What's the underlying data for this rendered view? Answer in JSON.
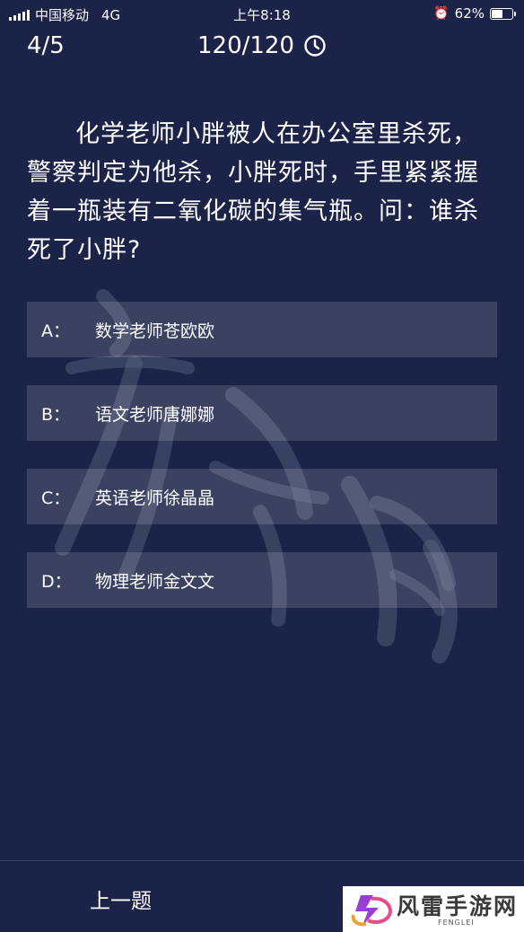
{
  "status": {
    "carrier": "中国移动",
    "network": "4G",
    "time": "上午8:18",
    "battery": "62%",
    "battery_level": 0.62
  },
  "header": {
    "progress": "4/5",
    "timer": "120/120"
  },
  "question": {
    "text": "化学老师小胖被人在办公室里杀死，警察判定为他杀，小胖死时，手里紧紧握着一瓶装有二氧化碳的集气瓶。问：谁杀死了小胖?"
  },
  "options": [
    {
      "key": "A：",
      "text": "数学老师苍欧欧"
    },
    {
      "key": "B：",
      "text": "语文老师唐娜娜"
    },
    {
      "key": "C：",
      "text": "英语老师徐晶晶"
    },
    {
      "key": "D：",
      "text": "物理老师金文文"
    }
  ],
  "footer": {
    "prev_label": "上一题"
  },
  "logo": {
    "name": "风雷手游网",
    "subtitle": "FENGLEI"
  }
}
